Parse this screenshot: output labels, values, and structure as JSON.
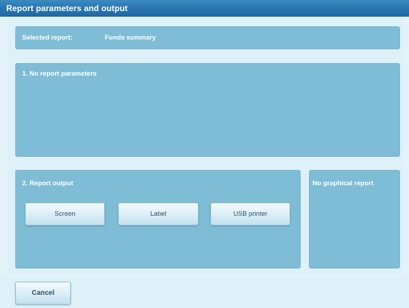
{
  "window": {
    "title": "Report parameters and output"
  },
  "selected_report": {
    "label": "Selected report:",
    "value": "Funds summary"
  },
  "parameters": {
    "heading": "1. No report parameters"
  },
  "output": {
    "heading": "2. Report output",
    "buttons": [
      "Screen",
      "Label",
      "USB printer"
    ]
  },
  "graphical": {
    "heading": "No graphical report"
  },
  "footer": {
    "cancel_label": "Cancel"
  },
  "colors": {
    "titlebar": "#2a73ad",
    "panel": "#7fbdd6",
    "background": "#e4f3fa",
    "button_text": "#2c4f67"
  }
}
